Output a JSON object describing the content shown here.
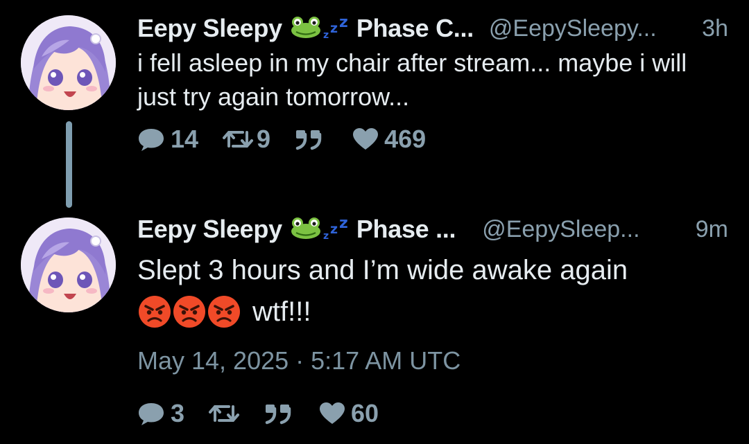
{
  "thread": {
    "tweets": [
      {
        "display_name": "Eepy Sleepy",
        "name_suffix": "Phase C...",
        "handle": "@EepySleepy...",
        "time": "3h",
        "text": "i fell asleep in my chair after stream... maybe i will just try again tomorrow...",
        "replies": "14",
        "retweets": "9",
        "likes": "469"
      },
      {
        "display_name": "Eepy Sleepy",
        "name_suffix": "Phase ...",
        "handle": "@EepySleep...",
        "time": "9m",
        "text_line1": "Slept 3 hours and I’m wide awake again",
        "text_line2": "wtf!!!",
        "timestamp": "May 14, 2025 · 5:17 AM UTC",
        "replies": "3",
        "likes": "60"
      }
    ]
  },
  "icons": {
    "reply": "speech-bubble-icon",
    "retweet": "retweet-icon",
    "quote": "quote-icon",
    "like": "heart-icon",
    "frog": "frog-emoji",
    "sleep": "zzz-emoji",
    "angry": "angry-face-emoji"
  },
  "colors": {
    "background": "#000000",
    "text": "#e6ecf0",
    "muted": "#8aa0ae",
    "thread_line": "#7f9eb0",
    "zzz": "#2f63d8"
  }
}
